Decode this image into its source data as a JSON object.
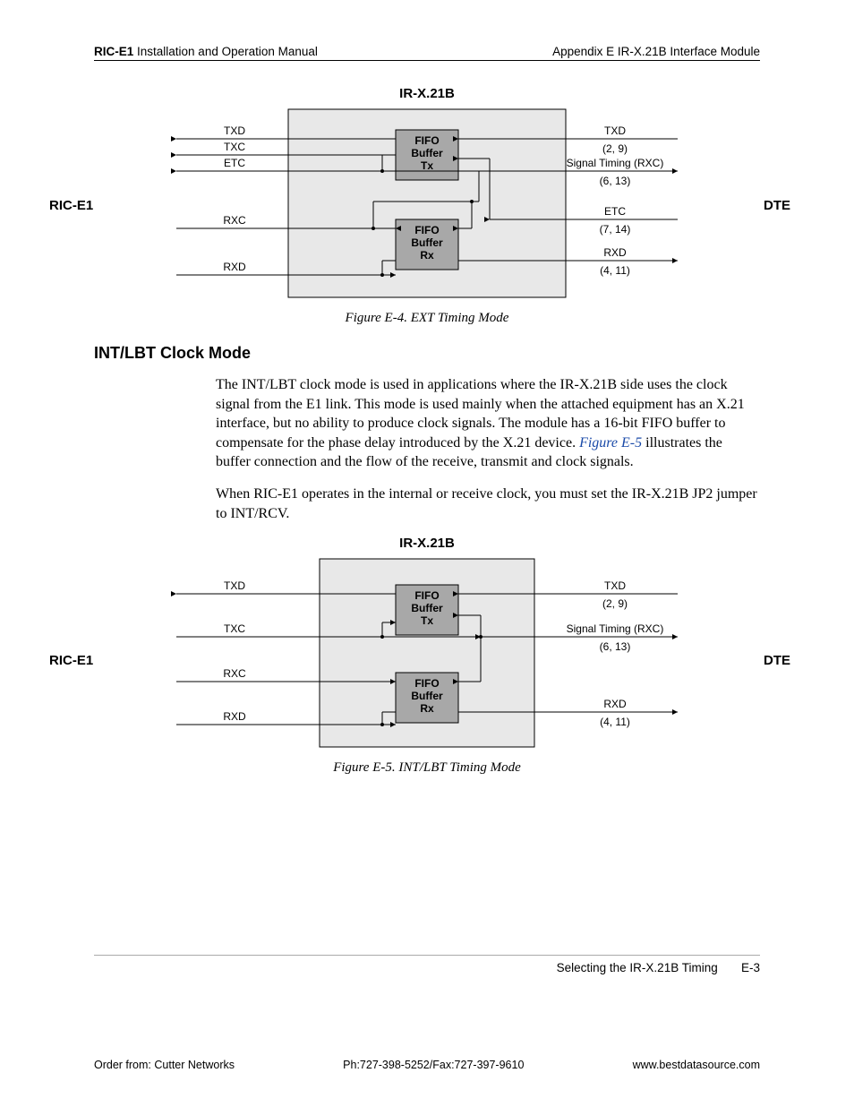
{
  "header": {
    "left_bold": "RIC-E1",
    "left_rest": " Installation and Operation Manual",
    "right": "Appendix E  IR-X.21B Interface Module"
  },
  "fig1": {
    "title": "IR-X.21B",
    "left_side": "RIC-E1",
    "right_side": "DTE",
    "box_tx_l1": "FIFO",
    "box_tx_l2": "Buffer",
    "box_tx_l3": "Tx",
    "box_rx_l1": "FIFO",
    "box_rx_l2": "Buffer",
    "box_rx_l3": "Rx",
    "left_labels": {
      "txd": "TXD",
      "txc": "TXC",
      "etc": "ETC",
      "rxc": "RXC",
      "rxd": "RXD"
    },
    "right_labels": {
      "txd": "TXD",
      "txd_pins": "(2, 9)",
      "rxc": "Signal Timing (RXC)",
      "rxc_pins": "(6, 13)",
      "etc": "ETC",
      "etc_pins": "(7, 14)",
      "rxd": "RXD",
      "rxd_pins": "(4, 11)"
    },
    "caption": "Figure E-4.  EXT Timing Mode"
  },
  "section_heading": "INT/LBT Clock Mode",
  "para1_a": "The INT/LBT clock mode is used in applications where the IR-X.21B side uses the clock signal from the E1 link. This mode is used mainly when the attached equipment has an X.21 interface, but no ability to produce clock signals. The module has a 16-bit FIFO buffer to compensate for the phase delay introduced by the X.21 device. ",
  "para1_ref": "Figure E-5",
  "para1_b": " illustrates the buffer connection and the flow of the receive, transmit and clock signals.",
  "para2": "When RIC-E1 operates in the internal or receive clock, you must set the IR-X.21B JP2 jumper to INT/RCV.",
  "fig2": {
    "title": "IR-X.21B",
    "left_side": "RIC-E1",
    "right_side": "DTE",
    "box_tx_l1": "FIFO",
    "box_tx_l2": "Buffer",
    "box_tx_l3": "Tx",
    "box_rx_l1": "FIFO",
    "box_rx_l2": "Buffer",
    "box_rx_l3": "Rx",
    "left_labels": {
      "txd": "TXD",
      "txc": "TXC",
      "rxc": "RXC",
      "rxd": "RXD"
    },
    "right_labels": {
      "txd": "TXD",
      "txd_pins": "(2, 9)",
      "rxc": "Signal Timing (RXC)",
      "rxc_pins": "(6, 13)",
      "rxd": "RXD",
      "rxd_pins": "(4, 11)"
    },
    "caption": "Figure E-5.  INT/LBT Timing Mode"
  },
  "footer": {
    "section": "Selecting the IR-X.21B Timing",
    "page": "E-3"
  },
  "orderline": {
    "left": "Order from: Cutter Networks",
    "mid": "Ph:727-398-5252/Fax:727-397-9610",
    "right": "www.bestdatasource.com"
  }
}
